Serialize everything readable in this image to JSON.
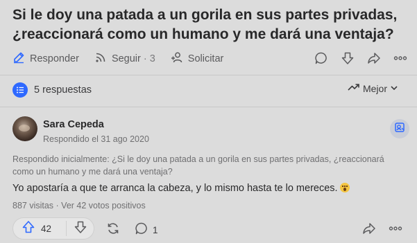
{
  "question": {
    "title": "Si le doy una patada a un gorila en sus partes privadas, ¿reaccionará como un humano y me dará una ventaja?"
  },
  "question_actions": {
    "answer_label": "Responder",
    "follow_label": "Seguir",
    "follow_count": "· 3",
    "request_label": "Solicitar"
  },
  "answers_bar": {
    "count_label": "5 respuestas",
    "sort_label": "Mejor"
  },
  "answer": {
    "author": "Sara Cepeda",
    "date": "Respondido el 31 ago 2020",
    "original_question": "Respondido inicialmente: ¿Si le doy una patada a un gorila en sus partes privadas, ¿reaccionará como un humano y me dará una ventaja?",
    "text": "Yo apostaría a que te arranca la cabeza, y lo mismo hasta te lo mereces.",
    "stats": "887 visitas · Ver 42 votos positivos",
    "upvotes": "42",
    "comments": "1"
  },
  "icons": {
    "answer": "edit-icon",
    "follow": "rss-icon",
    "request": "person-add-icon",
    "comment": "comment-icon",
    "downvote": "downvote-icon",
    "share": "share-icon",
    "more": "more-icon",
    "answers": "list-icon",
    "sort": "trend-icon",
    "reshare": "reshare-icon",
    "suggest": "suggest-edit-icon",
    "upvote": "upvote-icon"
  },
  "colors": {
    "accent": "#2e69ff",
    "background": "#dcdcdc"
  }
}
